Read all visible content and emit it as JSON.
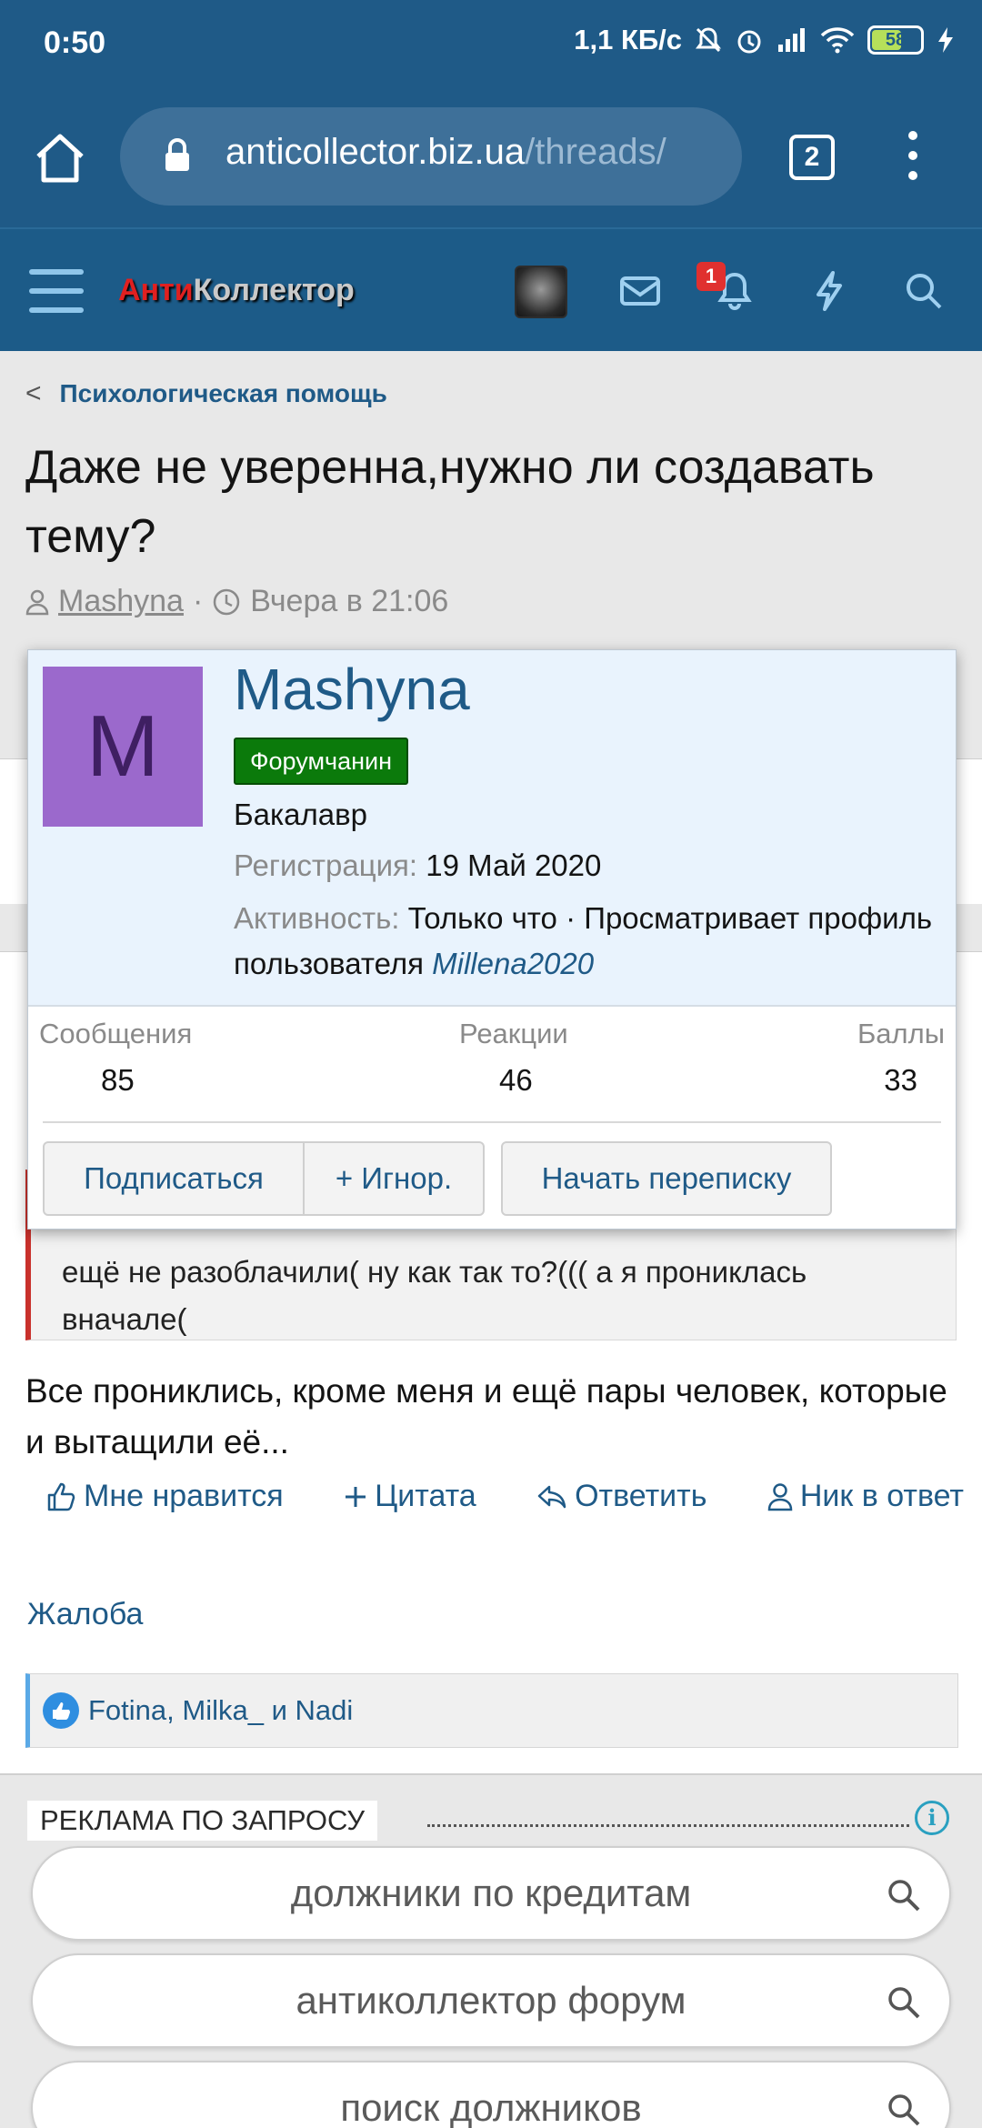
{
  "status_bar": {
    "time": "0:50",
    "net_speed": "1,1 КБ/с",
    "battery": "58"
  },
  "browser": {
    "url_host": "anticollector.biz.ua",
    "url_path": "/threads/",
    "tab_count": "2"
  },
  "site_header": {
    "logo_part1": "Анти",
    "logo_part2": "Коллектор",
    "notification_count": "1"
  },
  "thread": {
    "breadcrumb": "Психологическая помощь",
    "title": "Даже не уверенна,нужно ли создавать тему?",
    "author": "Mashyna",
    "separator": "·",
    "date": "Вчера в 21:06"
  },
  "post": {
    "quote_text": "ещё не разоблачили( ну как так то?((( а я прониклась вначале(",
    "body": "Все прониклись, кроме меня и ещё пары человек, которые и вытащили её...",
    "actions": {
      "like": "Мне нравится",
      "quote": "Цитата",
      "reply": "Ответить",
      "mention": "Ник в ответ"
    },
    "report": "Жалоба",
    "reactions": "Fotina, Milka_ и Nadi"
  },
  "member_card": {
    "avatar_letter": "M",
    "name": "Mashyna",
    "badge": "Форумчанин",
    "rank": "Бакалавр",
    "registration_label": "Регистрация:",
    "registration_value": "19 Май 2020",
    "activity_label": "Активность:",
    "activity_value": "Только что · Просматривает профиль пользователя",
    "activity_link": "Millena2020",
    "stats": [
      {
        "label": "Сообщения",
        "value": "85"
      },
      {
        "label": "Реакции",
        "value": "46"
      },
      {
        "label": "Баллы",
        "value": "33"
      }
    ],
    "buttons": {
      "follow": "Подписаться",
      "ignore": "+ Игнор.",
      "message": "Начать переписку"
    }
  },
  "ads": {
    "label": "РЕКЛАМА ПО ЗАПРОСУ",
    "items": [
      "должники по кредитам",
      "антиколлектор форум",
      "поиск должников"
    ]
  },
  "colors": {
    "header_blue": "#1f5a87",
    "link_blue": "#1f5a87",
    "badge_green": "#0b7a0b",
    "avatar_purple": "#9b69cc",
    "quote_border_red": "#c9312c"
  }
}
